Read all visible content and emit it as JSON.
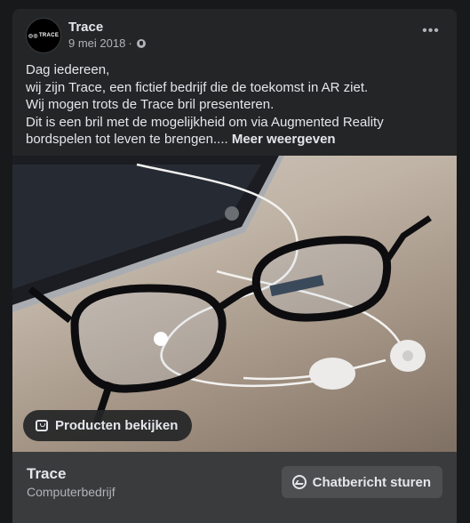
{
  "post": {
    "page_name": "Trace",
    "avatar_text": "TRACE",
    "date": "9 mei 2018",
    "separator": "·",
    "more_label": "•••",
    "text_lines": [
      "Dag iedereen,",
      "wij zijn Trace, een fictief bedrijf die de toekomst in AR ziet.",
      "Wij mogen trots de Trace bril presenteren.",
      "Dit is een bril met de mogelijkheid om via Augmented Reality",
      "bordspelen tot leven te brengen...."
    ],
    "see_more": "Meer weergeven",
    "products_button": "Producten bekijken"
  },
  "footer": {
    "name": "Trace",
    "category": "Computerbedrijf",
    "chat_button": "Chatbericht sturen"
  },
  "icons": {
    "privacy": "globe-icon",
    "options": "more-options-icon",
    "products": "shopping-bag-icon",
    "chat": "messenger-icon"
  },
  "colors": {
    "background": "#18191a",
    "card": "#242526",
    "footer": "#3a3b3c",
    "text_primary": "#e4e6eb",
    "text_secondary": "#b0b3b8"
  }
}
